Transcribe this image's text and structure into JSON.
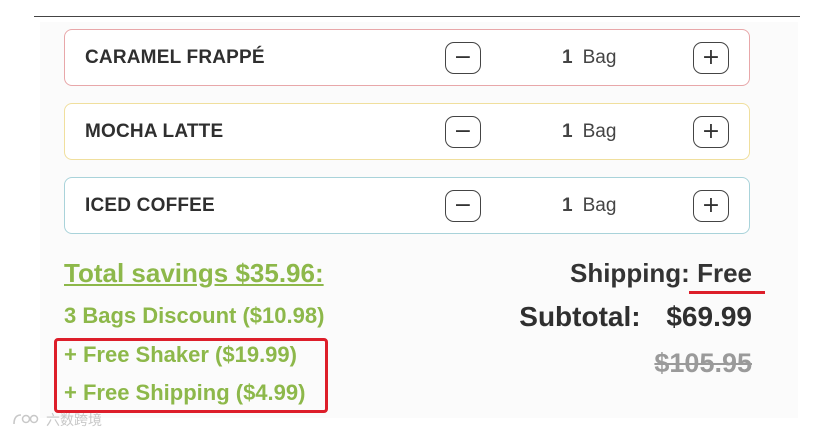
{
  "cart": {
    "items": [
      {
        "name": "CARAMEL FRAPPÉ",
        "qty": "1",
        "unit": "Bag",
        "border_color": "#e8a7a9"
      },
      {
        "name": "MOCHA LATTE",
        "qty": "1",
        "unit": "Bag",
        "border_color": "#f0df9d"
      },
      {
        "name": "ICED COFFEE",
        "qty": "1",
        "unit": "Bag",
        "border_color": "#a9d3da"
      }
    ],
    "minus_symbol": "−",
    "plus_symbol": "+"
  },
  "savings": {
    "title": "Total savings $35.96:",
    "lines": [
      "3 Bags Discount ($10.98)",
      "+ Free Shaker ($19.99)",
      "+ Free Shipping ($4.99)"
    ]
  },
  "totals": {
    "shipping_label": "Shipping:",
    "shipping_value": "Free",
    "subtotal_label": "Subtotal:",
    "subtotal_value": "$69.99",
    "original_price": "$105.95"
  },
  "colors": {
    "savings_green": "#8db84a",
    "highlight_red": "#dd1e2a"
  },
  "watermark": {
    "text": "六数跨境",
    "icon": "logo-mark"
  }
}
